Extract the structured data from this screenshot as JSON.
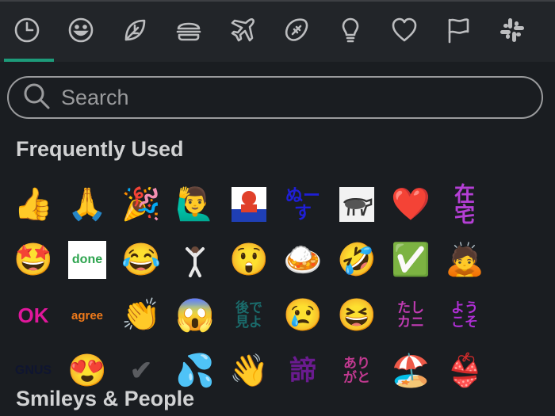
{
  "tabs": [
    {
      "name": "tab-recent",
      "icon": "clock-icon",
      "active": true
    },
    {
      "name": "tab-smileys",
      "icon": "smiley-icon",
      "active": false
    },
    {
      "name": "tab-nature",
      "icon": "leaf-icon",
      "active": false
    },
    {
      "name": "tab-food",
      "icon": "burger-icon",
      "active": false
    },
    {
      "name": "tab-travel",
      "icon": "airplane-icon",
      "active": false
    },
    {
      "name": "tab-activity",
      "icon": "football-icon",
      "active": false
    },
    {
      "name": "tab-objects",
      "icon": "lightbulb-icon",
      "active": false
    },
    {
      "name": "tab-symbols",
      "icon": "heart-icon",
      "active": false
    },
    {
      "name": "tab-flags",
      "icon": "flag-icon",
      "active": false
    },
    {
      "name": "tab-custom",
      "icon": "slack-icon",
      "active": false
    }
  ],
  "search": {
    "placeholder": "Search"
  },
  "sections": {
    "frequently_used": "Frequently Used",
    "smileys_people": "Smileys & People"
  },
  "emoji_rows": [
    [
      {
        "kind": "emoji",
        "char": "👍",
        "name": "thumbs-up"
      },
      {
        "kind": "emoji",
        "char": "🙏",
        "name": "folded-hands"
      },
      {
        "kind": "emoji",
        "char": "🎉",
        "name": "party-popper"
      },
      {
        "kind": "emoji",
        "char": "🙋‍♂️",
        "name": "man-raising-hand"
      },
      {
        "kind": "image",
        "name": "custom-person-photo"
      },
      {
        "kind": "text",
        "text": "ぬーす",
        "color": "#1f1fd6",
        "name": "custom-nuusu"
      },
      {
        "kind": "image",
        "name": "custom-wildebeest-photo"
      },
      {
        "kind": "emoji",
        "char": "❤️",
        "name": "red-heart"
      },
      {
        "kind": "text",
        "text": "在宅",
        "color": "#b53fd6",
        "name": "custom-zaitaku"
      }
    ],
    [
      {
        "kind": "emoji",
        "char": "🤩",
        "name": "star-struck"
      },
      {
        "kind": "text",
        "text": "done",
        "color": "#2da44e",
        "name": "custom-done",
        "bg": "#ffffff"
      },
      {
        "kind": "emoji",
        "char": "😂",
        "name": "tears-of-joy"
      },
      {
        "kind": "image",
        "name": "custom-dancing-man"
      },
      {
        "kind": "emoji",
        "char": "😲",
        "name": "astonished-face"
      },
      {
        "kind": "emoji",
        "char": "🍛",
        "name": "curry-rice"
      },
      {
        "kind": "emoji",
        "char": "🤣",
        "name": "rolling-on-floor-laughing"
      },
      {
        "kind": "emoji",
        "char": "✅",
        "name": "check-mark-button"
      },
      {
        "kind": "emoji",
        "char": "🙇",
        "name": "person-bowing"
      }
    ],
    [
      {
        "kind": "text",
        "text": "OK",
        "color": "#e0179b",
        "name": "custom-ok"
      },
      {
        "kind": "text",
        "text": "agree",
        "color": "#f07a1a",
        "name": "custom-agree"
      },
      {
        "kind": "emoji",
        "char": "👏",
        "name": "clapping-hands"
      },
      {
        "kind": "emoji",
        "char": "😱",
        "name": "screaming-face"
      },
      {
        "kind": "text",
        "text": "後で見よ",
        "color": "#1a6b6b",
        "name": "custom-atodemiyo"
      },
      {
        "kind": "emoji",
        "char": "😢",
        "name": "crying-face"
      },
      {
        "kind": "emoji",
        "char": "😆",
        "name": "grinning-squinting-face"
      },
      {
        "kind": "text",
        "text": "たしカニ",
        "color": "#c13bb3",
        "name": "custom-tashikani"
      },
      {
        "kind": "text",
        "text": "ようこそ",
        "color": "#b02fd6",
        "name": "custom-youkoso"
      }
    ],
    [
      {
        "kind": "text",
        "text": "GNUS",
        "color": "#0f1530",
        "name": "custom-gnus"
      },
      {
        "kind": "emoji",
        "char": "😍",
        "name": "heart-eyes"
      },
      {
        "kind": "text",
        "text": "✔",
        "color": "#5a5c60",
        "name": "custom-gray-check"
      },
      {
        "kind": "emoji",
        "char": "💦",
        "name": "sweat-droplets"
      },
      {
        "kind": "emoji",
        "char": "👋",
        "name": "waving-hand"
      },
      {
        "kind": "text",
        "text": "諦",
        "color": "#6a1b8f",
        "name": "custom-akirame"
      },
      {
        "kind": "text",
        "text": "ありがと",
        "color": "#c0398f",
        "name": "custom-arigato"
      },
      {
        "kind": "emoji",
        "char": "🏖️",
        "name": "beach-umbrella"
      },
      {
        "kind": "emoji",
        "char": "👙",
        "name": "bikini"
      }
    ]
  ],
  "colors": {
    "background": "#1a1d21",
    "tab_bar": "#222529",
    "active_indicator": "#1d9b7a",
    "icon": "#bcbdbf",
    "search_border": "#9a9b9d"
  }
}
